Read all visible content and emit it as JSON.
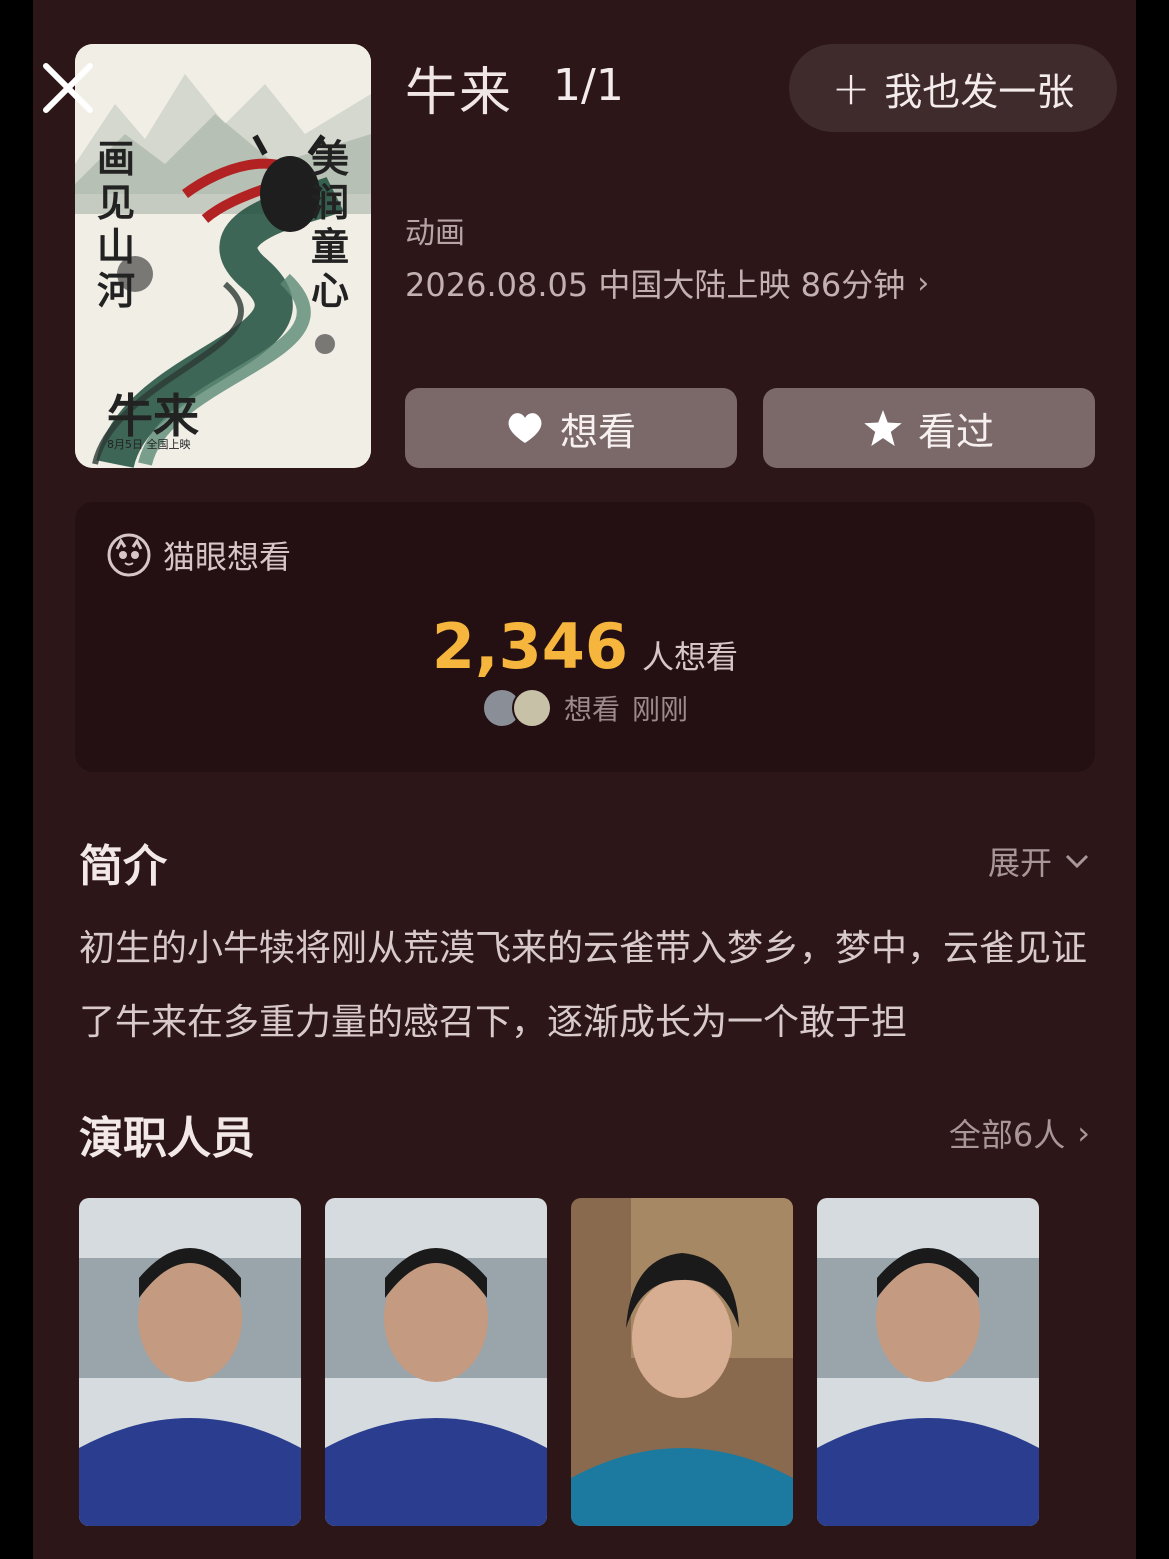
{
  "header": {
    "title": "牛来",
    "counter": "1/1",
    "add_button": "我也发一张"
  },
  "poster": {
    "vertical_left": "画见山河",
    "vertical_right": "美润童心",
    "logo": "牛来",
    "date_line": "8月5日 全国上映"
  },
  "movie": {
    "genre": "动画",
    "release": "2026.08.05 中国大陆上映 86分钟"
  },
  "actions": {
    "want": "想看",
    "seen": "看过"
  },
  "maoyan": {
    "label": "猫眼想看",
    "count": "2,346",
    "count_unit": "人想看",
    "activity_action": "想看",
    "activity_time": "刚刚"
  },
  "intro": {
    "title": "简介",
    "expand": "展开",
    "text": "初生的小牛犊将刚从荒漠飞来的云雀带入梦乡，梦中，云雀见证了牛来在多重力量的感召下，逐渐成长为一个敢于担"
  },
  "cast": {
    "title": "演职人员",
    "all": "全部6人"
  },
  "colors": {
    "background": "#2d1618",
    "accent": "#f6b53d",
    "button": "#7b6869"
  }
}
